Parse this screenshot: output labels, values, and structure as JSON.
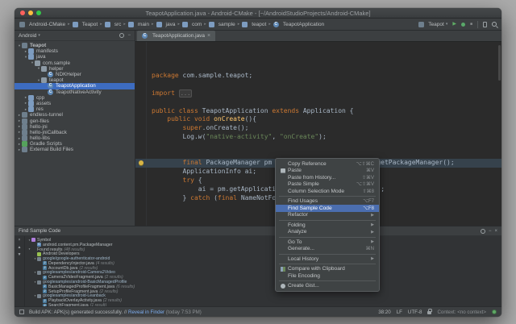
{
  "icons": {
    "chevron": "▸",
    "caret_down": "▾",
    "arrow_open": "▾",
    "arrow_closed": "▸",
    "run": "▶",
    "stop": "■",
    "close": "×",
    "minimize": "−",
    "submenu_arrow": "▶",
    "up": "▲",
    "down": "▼",
    "tab_close": "×",
    "class_letter": "C",
    "java_letter": "J"
  },
  "window": {
    "title": "TeapotApplication.java - Android-CMake - [~/AndroidStudioProjects/Android-CMake]"
  },
  "navbar": {
    "breadcrumbs": [
      {
        "label": "Android-CMake",
        "icon": "module"
      },
      {
        "label": "Teapot",
        "icon": "folder"
      },
      {
        "label": "src",
        "icon": "folder"
      },
      {
        "label": "main",
        "icon": "folder"
      },
      {
        "label": "java",
        "icon": "folder"
      },
      {
        "label": "com",
        "icon": "folder"
      },
      {
        "label": "sample",
        "icon": "folder"
      },
      {
        "label": "teapot",
        "icon": "folder"
      },
      {
        "label": "TeapotApplication",
        "icon": "class"
      }
    ],
    "run_config": "Teapot"
  },
  "project_panel": {
    "view_selector": "Android",
    "tree": [
      {
        "label": "Teapot",
        "depth": 0,
        "expand": "open",
        "icon": "module",
        "bold": true
      },
      {
        "label": "manifests",
        "depth": 1,
        "expand": "closed",
        "icon": "folder"
      },
      {
        "label": "java",
        "depth": 1,
        "expand": "open",
        "icon": "folder"
      },
      {
        "label": "com.sample",
        "depth": 2,
        "expand": "open",
        "icon": "package"
      },
      {
        "label": "helper",
        "depth": 3,
        "expand": "open",
        "icon": "package"
      },
      {
        "label": "NDKHelper",
        "depth": 4,
        "icon": "class"
      },
      {
        "label": "teapot",
        "depth": 3,
        "expand": "open",
        "icon": "package"
      },
      {
        "label": "TeapotApplication",
        "depth": 4,
        "icon": "class",
        "selected": true
      },
      {
        "label": "TeapotNativeActivity",
        "depth": 4,
        "icon": "class"
      },
      {
        "label": "cpp",
        "depth": 1,
        "expand": "closed",
        "icon": "folder"
      },
      {
        "label": "assets",
        "depth": 1,
        "expand": "closed",
        "icon": "folder"
      },
      {
        "label": "res",
        "depth": 1,
        "expand": "closed",
        "icon": "folder"
      },
      {
        "label": "endless-tunnel",
        "depth": 0,
        "expand": "closed",
        "icon": "module"
      },
      {
        "label": "gen-files",
        "depth": 0,
        "expand": "closed",
        "icon": "module"
      },
      {
        "label": "hello-jni",
        "depth": 0,
        "expand": "closed",
        "icon": "module"
      },
      {
        "label": "hello-jniCallback",
        "depth": 0,
        "expand": "closed",
        "icon": "module"
      },
      {
        "label": "hello-libs",
        "depth": 0,
        "expand": "closed",
        "icon": "module"
      },
      {
        "label": "Gradle Scripts",
        "depth": 0,
        "expand": "closed",
        "icon": "gradle"
      },
      {
        "label": "External Build Files",
        "depth": 0,
        "expand": "closed",
        "icon": "ext"
      }
    ]
  },
  "editor": {
    "tab_title": "TeapotApplication.java",
    "lines": [
      {
        "s": [
          [
            "kw",
            "package "
          ],
          [
            "pl",
            "com.sample.teapot;"
          ]
        ]
      },
      {
        "s": []
      },
      {
        "s": [
          [
            "kw",
            "import "
          ],
          [
            "fold",
            "..."
          ]
        ]
      },
      {
        "s": []
      },
      {
        "s": [
          [
            "kw",
            "public class "
          ],
          [
            "pl",
            "TeapotApplication "
          ],
          [
            "kw",
            "extends "
          ],
          [
            "pl",
            "Application {"
          ]
        ]
      },
      {
        "s": [
          [
            "pl",
            "    "
          ],
          [
            "kw",
            "public void "
          ],
          [
            "fn",
            "onCreate"
          ],
          [
            "pl",
            "(){"
          ]
        ]
      },
      {
        "s": [
          [
            "pl",
            "        "
          ],
          [
            "kw",
            "super"
          ],
          [
            "pl",
            ".onCreate();"
          ]
        ]
      },
      {
        "s": [
          [
            "pl",
            "        Log."
          ],
          [
            "st",
            "w"
          ],
          [
            "pl",
            "("
          ],
          [
            "str",
            "\"native-activity\""
          ],
          [
            "pl",
            ", "
          ],
          [
            "str",
            "\"onCreate\""
          ],
          [
            "pl",
            ");"
          ]
        ]
      },
      {
        "s": []
      },
      {
        "s": []
      },
      {
        "hl": true,
        "bulb": true,
        "s": [
          [
            "pl",
            "        "
          ],
          [
            "kw",
            "final "
          ],
          [
            "pl",
            "PackageManager pm = getApplicationContext().getPackageManager();"
          ]
        ]
      },
      {
        "s": [
          [
            "pl",
            "        ApplicationInfo ai;"
          ]
        ]
      },
      {
        "s": [
          [
            "pl",
            "        "
          ],
          [
            "kw",
            "try "
          ],
          [
            "pl",
            "{"
          ]
        ]
      },
      {
        "s": [
          [
            "pl",
            "            ai = pm.getApplicationInfo(getPackageName(), "
          ],
          [
            "num",
            "0"
          ],
          [
            "pl",
            ");"
          ]
        ]
      },
      {
        "s": [
          [
            "pl",
            "        } "
          ],
          [
            "kw",
            "catch "
          ],
          [
            "pl",
            "("
          ],
          [
            "kw",
            "final "
          ],
          [
            "pl",
            "NameNotFoundException e) {"
          ]
        ]
      }
    ]
  },
  "context_menu": {
    "items": [
      {
        "label": "Copy Reference",
        "shortcut": "⌥⇧⌘C"
      },
      {
        "label": "Paste",
        "shortcut": "⌘V",
        "icon": "paste"
      },
      {
        "label": "Paste from History...",
        "shortcut": "⇧⌘V"
      },
      {
        "label": "Paste Simple",
        "shortcut": "⌥⇧⌘V"
      },
      {
        "label": "Column Selection Mode",
        "shortcut": "⇧⌘8"
      },
      {
        "sep": true
      },
      {
        "label": "Find Usages",
        "shortcut": "⌥F7"
      },
      {
        "label": "Find Sample Code",
        "shortcut": "⌥F8",
        "selected": true
      },
      {
        "label": "Refactor",
        "submenu": true
      },
      {
        "sep": true
      },
      {
        "label": "Folding",
        "submenu": true
      },
      {
        "label": "Analyze",
        "submenu": true
      },
      {
        "sep": true
      },
      {
        "label": "Go To",
        "submenu": true
      },
      {
        "label": "Generate...",
        "shortcut": "⌘N"
      },
      {
        "sep": true
      },
      {
        "label": "Local History",
        "submenu": true
      },
      {
        "sep": true
      },
      {
        "label": "Compare with Clipboard",
        "icon": "diff"
      },
      {
        "label": "File Encoding"
      },
      {
        "sep": true
      },
      {
        "label": "Create Gist...",
        "icon": "gist"
      }
    ]
  },
  "find_panel": {
    "title": "Find Sample Code",
    "tree": [
      {
        "label": "Symbol",
        "depth": 0,
        "expand": "open",
        "icon": "symbol"
      },
      {
        "label": "android.content.pm.PackageManager",
        "depth": 1,
        "icon": "class"
      },
      {
        "label": "Found results",
        "suffix": "(48 results)",
        "depth": 0,
        "expand": "open",
        "icon": "none"
      },
      {
        "label": "Android Developers",
        "depth": 1,
        "icon": "android"
      },
      {
        "label": "google/google-authenticator-android",
        "depth": 1,
        "expand": "open",
        "icon": "repo",
        "color": "#9fb6c8"
      },
      {
        "label": "DependencyInjector.java",
        "suffix": "(4 results)",
        "depth": 2,
        "icon": "java"
      },
      {
        "label": "AccountDb.java",
        "suffix": "(2 results)",
        "depth": 2,
        "icon": "java"
      },
      {
        "label": "googlesamples/android-Camera2Video",
        "depth": 1,
        "expand": "open",
        "icon": "repo",
        "color": "#9fb6c8"
      },
      {
        "label": "Camera2VideoFragment.java",
        "suffix": "(2 results)",
        "depth": 2,
        "icon": "java"
      },
      {
        "label": "googlesamples/android-BasicManagedProfile",
        "depth": 1,
        "expand": "open",
        "icon": "repo",
        "color": "#9fb6c8"
      },
      {
        "label": "BasicManagedProfileFragment.java",
        "suffix": "(6 results)",
        "depth": 2,
        "icon": "java"
      },
      {
        "label": "SetupProfileFragment.java",
        "suffix": "(2 results)",
        "depth": 2,
        "icon": "java"
      },
      {
        "label": "googlesamples/android-Leanback",
        "depth": 1,
        "expand": "open",
        "icon": "repo",
        "color": "#9fb6c8"
      },
      {
        "label": "PlaybackOverlayActivity.java",
        "suffix": "(2 results)",
        "depth": 2,
        "icon": "java"
      },
      {
        "label": "SearchFragment.java",
        "suffix": "(1 result)",
        "depth": 2,
        "icon": "java"
      }
    ]
  },
  "status_bar": {
    "message_prefix": "Build APK: APK(s) generated successfully. // ",
    "message_link": "Reveal in Finder",
    "message_suffix": " (today 7:53 PM)",
    "caret_position": "38:20",
    "line_ending": "LF",
    "encoding": "UTF-8",
    "context": "Context: <no context>"
  }
}
